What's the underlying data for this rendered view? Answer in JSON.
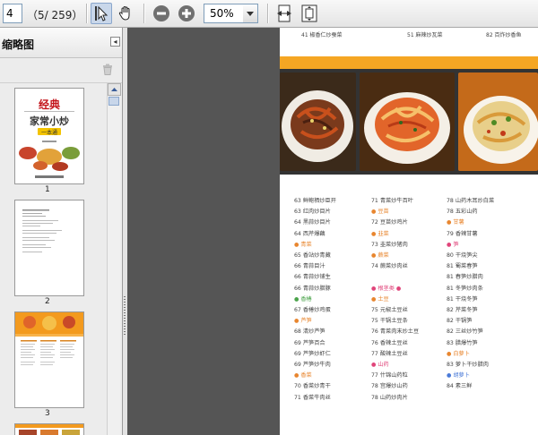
{
  "toolbar": {
    "page_value": "4",
    "page_count": "（5/ 259）",
    "zoom_value": "50%"
  },
  "sidebar": {
    "title": "缩略图",
    "close_glyph": "◂",
    "thumbnails": [
      {
        "number": "1",
        "cover_title": "经典",
        "cover_subtitle": "家常小炒",
        "cover_tag": "一本通"
      },
      {
        "number": "2"
      },
      {
        "number": "3"
      }
    ]
  },
  "page": {
    "top_toc": [
      "41 椒香仁炒蚕菜",
      "51 麻辣炒瓦菜",
      "82 百炸炒香鱼"
    ],
    "columns": [
      [
        {
          "t": "63 鲜鲍栖炒臣开"
        },
        {
          "t": "63 红肉炒目片"
        },
        {
          "t": "64 黑蒜炒目片"
        },
        {
          "t": "64 西芹爆藕"
        },
        {
          "t": "● 青菜",
          "c": "cat"
        },
        {
          "t": "65 香站炒青藏"
        },
        {
          "t": "66 青蒜目汁"
        },
        {
          "t": "66 青蒜炒铺生"
        },
        {
          "t": "66 青蒜炒腊豚"
        },
        {
          "t": "● 香椿",
          "c": "cat green"
        },
        {
          "t": "67 香椿炒鸡蛋"
        },
        {
          "t": "● 芦笋",
          "c": "cat"
        },
        {
          "t": "68 清炒芦笋"
        },
        {
          "t": "69 芦笋百合"
        },
        {
          "t": "69 芦笋炒虾仁"
        },
        {
          "t": "69 芦笋炒牛肉"
        },
        {
          "t": "● 香菜",
          "c": "cat"
        },
        {
          "t": "70 香菜炒青干"
        },
        {
          "t": "71 香菜牛肉丝"
        }
      ],
      [
        {
          "t": "71 青菜炒牛百叶"
        },
        {
          "t": "● 豆苗",
          "c": "cat"
        },
        {
          "t": "72 豆苗炒鸡片"
        },
        {
          "t": "● 韭菜",
          "c": "cat"
        },
        {
          "t": "73 韭菜炒猪肉"
        },
        {
          "t": "● 蕨菜",
          "c": "cat"
        },
        {
          "t": "74 蕨菜炒肉丝"
        },
        {
          "t": ""
        },
        {
          "t": "● 根茎类 ●",
          "c": "cat pink"
        },
        {
          "t": "● 土豆",
          "c": "cat"
        },
        {
          "t": "75 元椒土豆丝"
        },
        {
          "t": "75 干锅土豆条"
        },
        {
          "t": "76 青菜肉末炒土豆"
        },
        {
          "t": "76 香辣土豆丝"
        },
        {
          "t": "77 酸辣土豆丝"
        },
        {
          "t": "● 山药",
          "c": "cat pink"
        },
        {
          "t": "77 什锦山药粒"
        },
        {
          "t": "78 宫爆炒山药"
        },
        {
          "t": "78 山药炒肉片"
        }
      ],
      [
        {
          "t": "78 山药木耳炒白菜"
        },
        {
          "t": "78 五彩山药"
        },
        {
          "t": "● 甘薯",
          "c": "cat"
        },
        {
          "t": "79 香辣甘薯"
        },
        {
          "t": "● 笋",
          "c": "cat pink"
        },
        {
          "t": "80 干烧笋尖"
        },
        {
          "t": "81 蜀菜春笋"
        },
        {
          "t": "81 春笋炒腊肉"
        },
        {
          "t": "81 冬笋炒肉条"
        },
        {
          "t": "81 干烧冬笋"
        },
        {
          "t": "82 芹菜冬笋"
        },
        {
          "t": "82 干锅笋"
        },
        {
          "t": "82 三丝炒竹笋"
        },
        {
          "t": "83 腊爆竹笋"
        },
        {
          "t": "● 白萝卜",
          "c": "cat"
        },
        {
          "t": "83 萝卜干炒腊肉"
        },
        {
          "t": "● 胡萝卜",
          "c": "cat blue"
        },
        {
          "t": "84 素三鲜"
        }
      ]
    ]
  },
  "colors": {
    "orange": "#f5a623",
    "toolbar_bg": "#ececec",
    "doc_bg": "#555555"
  }
}
